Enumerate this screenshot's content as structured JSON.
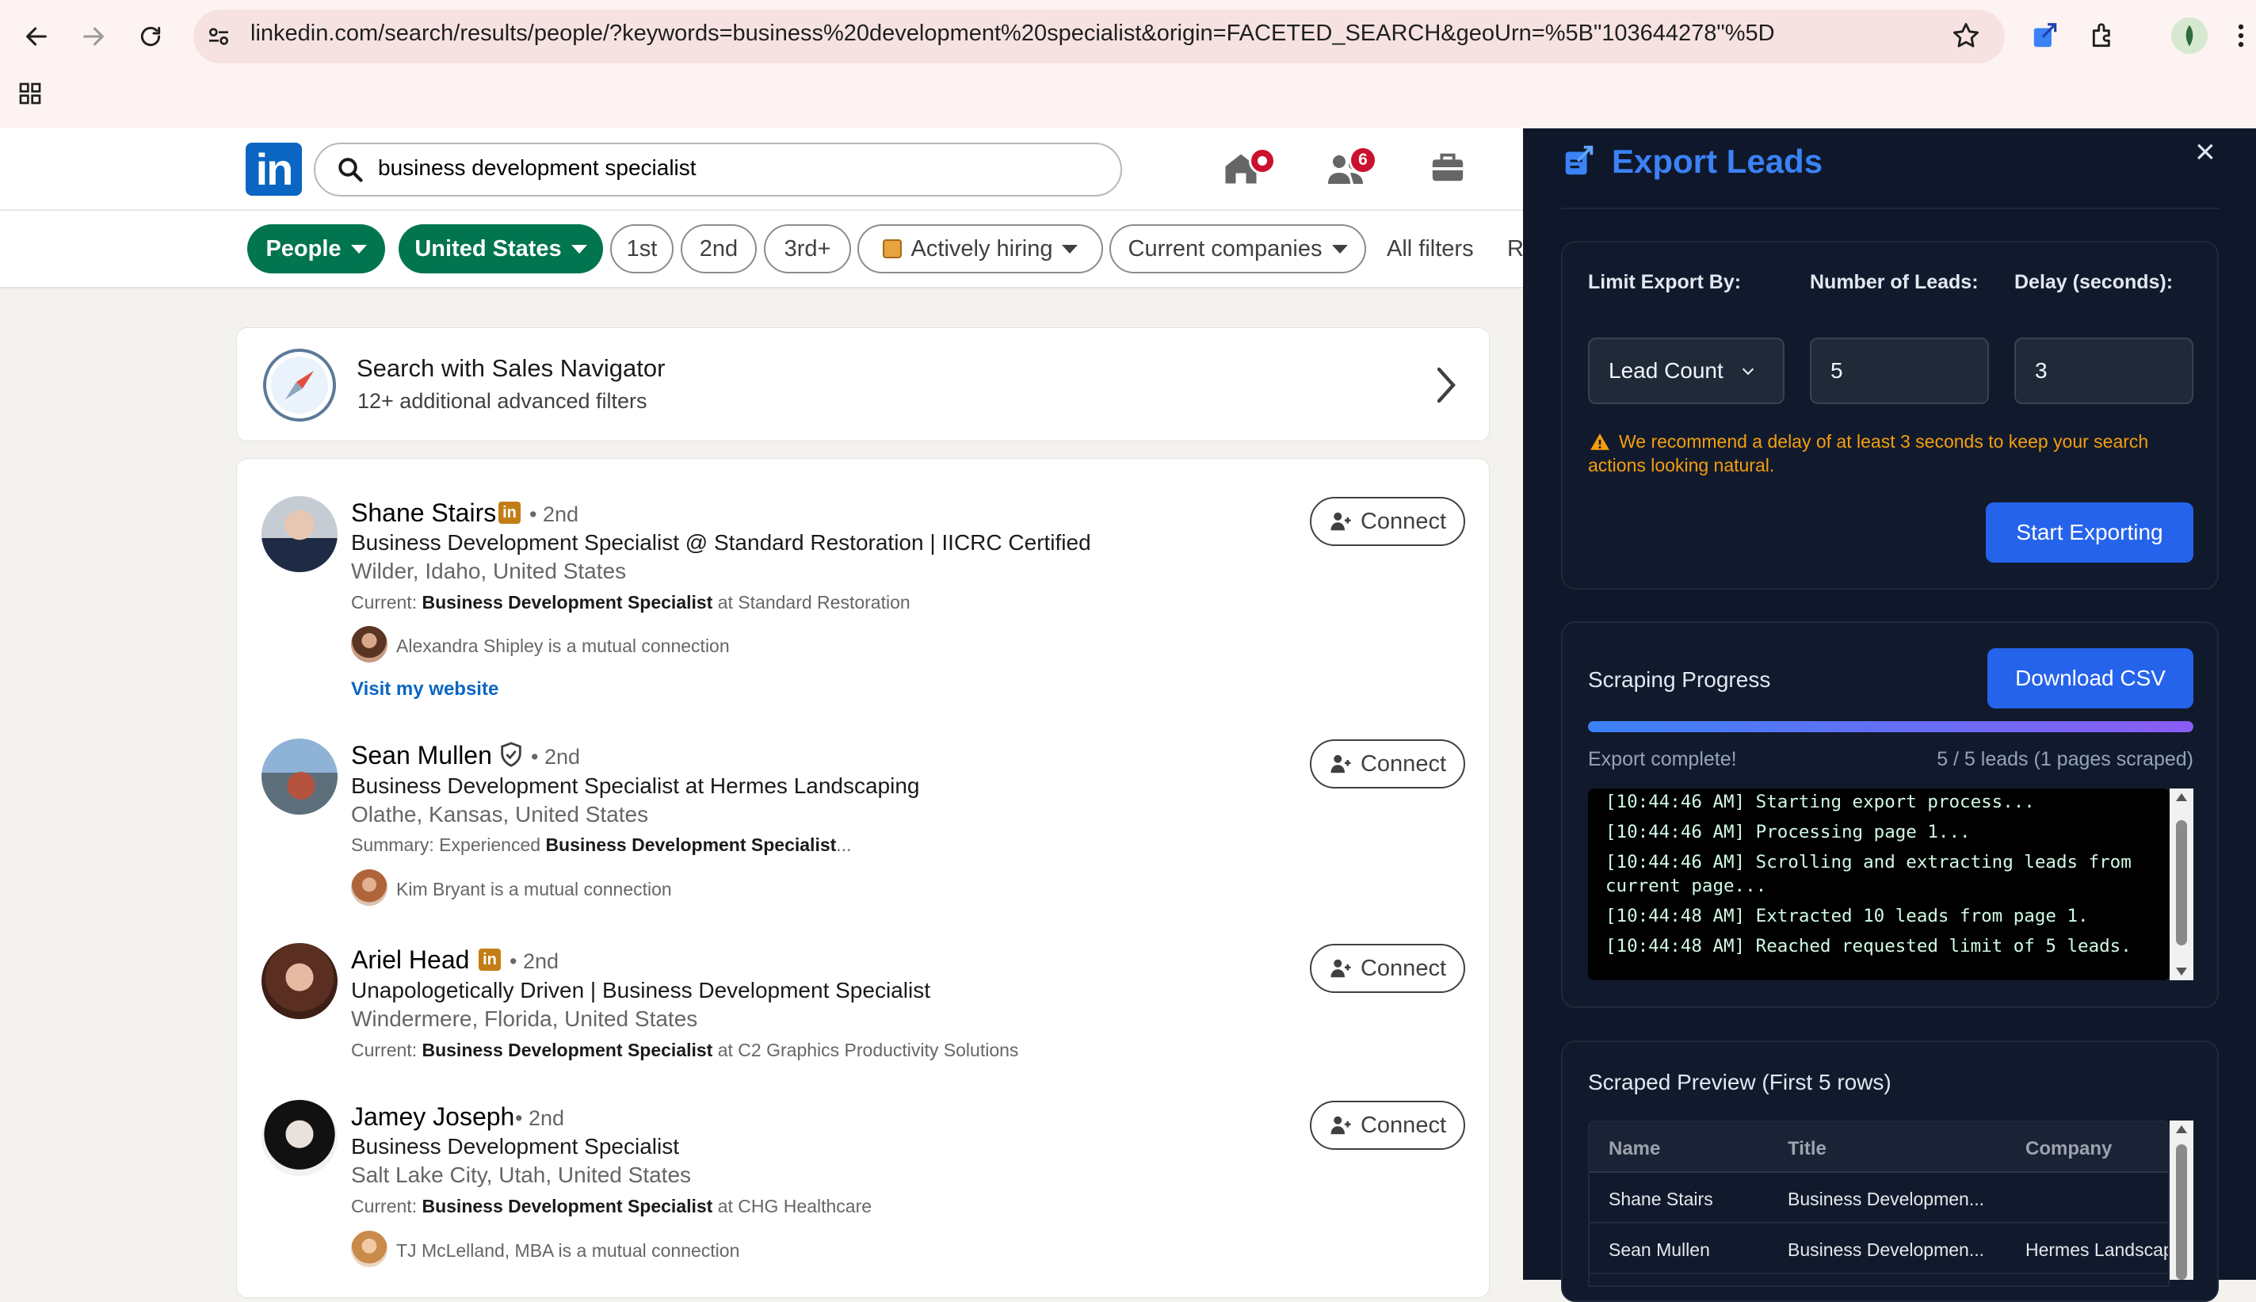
{
  "browser": {
    "url": "linkedin.com/search/results/people/?keywords=business%20development%20specialist&origin=FACETED_SEARCH&geoUrn=%5B\"103644278\"%5D"
  },
  "linkedin": {
    "logo_text": "in",
    "search_value": "business development specialist",
    "nav": {
      "notifications_badge": "6"
    },
    "filters": {
      "people": "People",
      "location": "United States",
      "first": "1st",
      "second": "2nd",
      "third": "3rd+",
      "actively_hiring": "Actively hiring",
      "current_companies": "Current companies",
      "all_filters": "All filters",
      "reset": "R"
    },
    "sales_nav": {
      "title": "Search with Sales Navigator",
      "subtitle": "12+ additional advanced filters"
    },
    "connect_label": "Connect",
    "results": [
      {
        "name": "Shane Stairs",
        "badge": "in",
        "degree": "• 2nd",
        "headline": "Business Development Specialist @ Standard Restoration | IICRC Certified",
        "location": "Wilder, Idaho, United States",
        "current_prefix": "Current: ",
        "current_bold": "Business Development Specialist",
        "current_suffix": " at Standard Restoration",
        "mutual": "Alexandra Shipley is a mutual connection",
        "link": "Visit my website"
      },
      {
        "name": "Sean Mullen",
        "degree": "• 2nd",
        "headline": "Business Development Specialist at Hermes Landscaping",
        "location": "Olathe, Kansas, United States",
        "current_prefix": "Summary: Experienced ",
        "current_bold": "Business Development Specialist",
        "current_suffix": "...",
        "mutual": "Kim Bryant is a mutual connection"
      },
      {
        "name": "Ariel Head",
        "badge": "in",
        "degree": "• 2nd",
        "headline": "Unapologetically Driven | Business Development Specialist",
        "location": "Windermere, Florida, United States",
        "current_prefix": "Current: ",
        "current_bold": "Business Development Specialist",
        "current_suffix": " at C2 Graphics Productivity Solutions"
      },
      {
        "name": "Jamey Joseph",
        "degree": "• 2nd",
        "headline": "Business Development Specialist",
        "location": "Salt Lake City, Utah, United States",
        "current_prefix": "Current: ",
        "current_bold": "Business Development Specialist",
        "current_suffix": " at CHG Healthcare",
        "mutual": "TJ McLelland, MBA is a mutual connection"
      }
    ]
  },
  "panel": {
    "title": "Export Leads",
    "close": "×",
    "limit_label": "Limit Export By:",
    "limit_value": "Lead Count",
    "count_label": "Number of Leads:",
    "count_value": "5",
    "delay_label": "Delay (seconds):",
    "delay_value": "3",
    "warning_line1": "We recommend a delay of at least 3 seconds to keep your search",
    "warning_line2": "actions looking natural.",
    "start_button": "Start Exporting",
    "progress_title": "Scraping Progress",
    "download_button": "Download CSV",
    "progress_fraction": 1.0,
    "status_left": "Export complete!",
    "status_right": "5 / 5 leads (1 pages scraped)",
    "log": [
      "[10:44:46 AM] Starting export process...",
      "[10:44:46 AM] Processing page 1...",
      "[10:44:46 AM] Scrolling and extracting leads from",
      "current page...",
      "[10:44:48 AM] Extracted 10 leads from page 1.",
      "[10:44:48 AM] Reached requested limit of 5 leads."
    ],
    "preview_title": "Scraped Preview (First 5 rows)",
    "table": {
      "headers": [
        "Name",
        "Title",
        "Company"
      ],
      "rows": [
        [
          "Shane Stairs",
          "Business Developmen...",
          ""
        ],
        [
          "Sean Mullen",
          "Business Developmen...",
          "Hermes Landscap"
        ]
      ]
    }
  },
  "colors": {
    "linkedin_blue": "#0a66c2",
    "linkedin_green": "#01754f",
    "panel_bg": "#0f172a",
    "accent_blue": "#2563eb",
    "warning": "#f59e0b"
  }
}
